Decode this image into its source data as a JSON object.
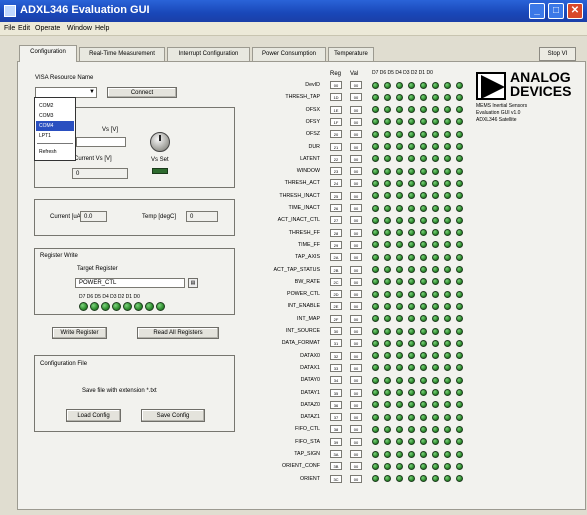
{
  "window": {
    "title": "ADXL346 Evaluation GUI",
    "menu": [
      "File",
      "Edit",
      "Operate",
      "Window",
      "Help"
    ]
  },
  "tabs": [
    {
      "label": "Configuration",
      "active": true
    },
    {
      "label": "Real-Time Measurement",
      "active": false
    },
    {
      "label": "Interrupt Configuration",
      "active": false
    },
    {
      "label": "Power Consumption",
      "active": false
    },
    {
      "label": "Temperature",
      "active": false
    }
  ],
  "stop_button": "Stop VI",
  "visa": {
    "label": "VISA Resource Name",
    "value": "",
    "connect_label": "Connect",
    "dropdown_options": [
      "COM2",
      "COM3",
      "COM4",
      "LPT1",
      "Refresh"
    ],
    "selected_option": "COM4"
  },
  "supply": {
    "vs_label": "Vs [V]",
    "current_vs_label": "Current Vs [V]",
    "current_vs_value": "0",
    "knob_label": "Vs Set"
  },
  "measure": {
    "current_label": "Current [uA]",
    "current_value": "0.0",
    "temp_label": "Temp [degC]",
    "temp_value": "0"
  },
  "register_write": {
    "title": "Register Write",
    "target_label": "Target Register",
    "target_value": "POWER_CTL",
    "bits_label": "D7  D6  D5  D4  D3  D2  D1  D0",
    "write_label": "Write Register",
    "read_all_label": "Read All Registers"
  },
  "config_file": {
    "title": "Configuration File",
    "note": "Save file with extension *.txt",
    "load_label": "Load Config",
    "save_label": "Save Config"
  },
  "register_table": {
    "reg_header": "Reg",
    "val_header": "Val",
    "bits_header": "D7  D6  D5  D4  D3  D2  D1  D0",
    "rows": [
      {
        "name": "DevID",
        "reg": "00",
        "val": "00"
      },
      {
        "name": "THRESH_TAP",
        "reg": "1D",
        "val": "00"
      },
      {
        "name": "OFSX",
        "reg": "1E",
        "val": "00"
      },
      {
        "name": "OFSY",
        "reg": "1F",
        "val": "00"
      },
      {
        "name": "OFSZ",
        "reg": "20",
        "val": "00"
      },
      {
        "name": "DUR",
        "reg": "21",
        "val": "00"
      },
      {
        "name": "LATENT",
        "reg": "22",
        "val": "00"
      },
      {
        "name": "WINDOW",
        "reg": "23",
        "val": "00"
      },
      {
        "name": "THRESH_ACT",
        "reg": "24",
        "val": "00"
      },
      {
        "name": "THRESH_INACT",
        "reg": "25",
        "val": "00"
      },
      {
        "name": "TIME_INACT",
        "reg": "26",
        "val": "00"
      },
      {
        "name": "ACT_INACT_CTL",
        "reg": "27",
        "val": "00"
      },
      {
        "name": "THRESH_FF",
        "reg": "28",
        "val": "00"
      },
      {
        "name": "TIME_FF",
        "reg": "29",
        "val": "00"
      },
      {
        "name": "TAP_AXIS",
        "reg": "2A",
        "val": "00"
      },
      {
        "name": "ACT_TAP_STATUS",
        "reg": "2B",
        "val": "00"
      },
      {
        "name": "BW_RATE",
        "reg": "2C",
        "val": "00"
      },
      {
        "name": "POWER_CTL",
        "reg": "2D",
        "val": "00"
      },
      {
        "name": "INT_ENABLE",
        "reg": "2E",
        "val": "00"
      },
      {
        "name": "INT_MAP",
        "reg": "2F",
        "val": "00"
      },
      {
        "name": "INT_SOURCE",
        "reg": "30",
        "val": "00"
      },
      {
        "name": "DATA_FORMAT",
        "reg": "31",
        "val": "00"
      },
      {
        "name": "DATAX0",
        "reg": "32",
        "val": "00"
      },
      {
        "name": "DATAX1",
        "reg": "33",
        "val": "00"
      },
      {
        "name": "DATAY0",
        "reg": "34",
        "val": "00"
      },
      {
        "name": "DATAY1",
        "reg": "35",
        "val": "00"
      },
      {
        "name": "DATAZ0",
        "reg": "36",
        "val": "00"
      },
      {
        "name": "DATAZ1",
        "reg": "37",
        "val": "00"
      },
      {
        "name": "FIFO_CTL",
        "reg": "38",
        "val": "00"
      },
      {
        "name": "FIFO_STA",
        "reg": "39",
        "val": "00"
      },
      {
        "name": "TAP_SIGN",
        "reg": "3A",
        "val": "00"
      },
      {
        "name": "ORIENT_CONF",
        "reg": "3B",
        "val": "00"
      },
      {
        "name": "ORIENT",
        "reg": "3C",
        "val": "00"
      }
    ]
  },
  "brand": {
    "logo_line1": "ANALOG",
    "logo_line2": "DEVICES",
    "info": [
      "MEMS Inertial Sensors",
      "Evaluation GUI v1.0",
      "ADXL346 Satellite"
    ]
  }
}
